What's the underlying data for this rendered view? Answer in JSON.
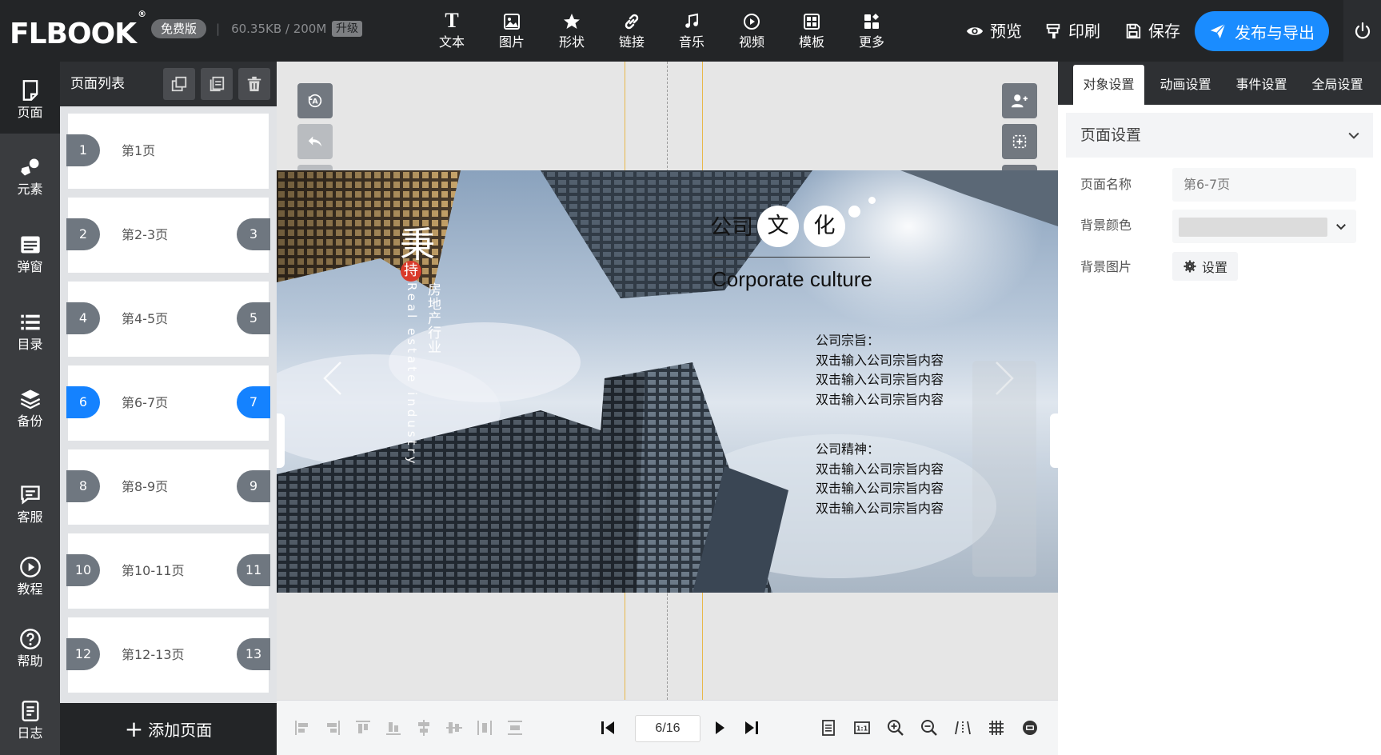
{
  "app": {
    "logo": "FLBOOK",
    "logo_mark": "®",
    "edition_badge": "免费版",
    "storage": "60.35KB / 200M",
    "storage_separator": "|",
    "upgrade": "升级"
  },
  "toolbar": {
    "items": [
      {
        "label": "文本",
        "icon": "text-icon"
      },
      {
        "label": "图片",
        "icon": "image-icon"
      },
      {
        "label": "形状",
        "icon": "star-icon"
      },
      {
        "label": "链接",
        "icon": "link-icon"
      },
      {
        "label": "音乐",
        "icon": "music-icon"
      },
      {
        "label": "视频",
        "icon": "play-circle-icon"
      },
      {
        "label": "模板",
        "icon": "template-icon"
      },
      {
        "label": "更多",
        "icon": "more-icon"
      }
    ],
    "preview": "预览",
    "print": "印刷",
    "save": "保存",
    "publish": "发布与导出"
  },
  "leftnav": {
    "items": [
      {
        "label": "页面",
        "icon": "page-icon"
      },
      {
        "label": "元素",
        "icon": "shapes-icon"
      },
      {
        "label": "弹窗",
        "icon": "popup-icon"
      },
      {
        "label": "目录",
        "icon": "list-icon"
      },
      {
        "label": "备份",
        "icon": "layers-icon"
      },
      {
        "label": "客服",
        "icon": "chat-icon"
      },
      {
        "label": "教程",
        "icon": "play-circle-icon"
      },
      {
        "label": "帮助",
        "icon": "help-icon"
      },
      {
        "label": "日志",
        "icon": "log-icon"
      }
    ]
  },
  "pagelist": {
    "title": "页面列表",
    "add_page": "添加页面",
    "pages": [
      {
        "left": "1",
        "right": "",
        "label": "第1页",
        "active": false
      },
      {
        "left": "2",
        "right": "3",
        "label": "第2-3页",
        "active": false
      },
      {
        "left": "4",
        "right": "5",
        "label": "第4-5页",
        "active": false
      },
      {
        "left": "6",
        "right": "7",
        "label": "第6-7页",
        "active": true
      },
      {
        "left": "8",
        "right": "9",
        "label": "第8-9页",
        "active": false
      },
      {
        "left": "10",
        "right": "11",
        "label": "第10-11页",
        "active": false
      },
      {
        "left": "12",
        "right": "13",
        "label": "第12-13页",
        "active": false
      }
    ]
  },
  "spread": {
    "vertical_title_big": "秉",
    "vertical_title_red": "持",
    "vertical_title_cn": "房地产行业",
    "vertical_title_en": "Real estate industry",
    "culture_prefix": "公司",
    "culture_c1": "文",
    "culture_c2": "化",
    "culture_en": "Corporate culture",
    "purpose_title": "公司宗旨：",
    "purpose_lines": [
      "双击输入公司宗旨内容",
      "双击输入公司宗旨内容",
      "双击输入公司宗旨内容"
    ],
    "spirit_title": "公司精神：",
    "spirit_lines": [
      "双击输入公司宗旨内容",
      "双击输入公司宗旨内容",
      "双击输入公司宗旨内容"
    ]
  },
  "pager": {
    "current": "6/16"
  },
  "rightpanel": {
    "tabs": [
      "对象设置",
      "动画设置",
      "事件设置",
      "全局设置"
    ],
    "section_title": "页面设置",
    "page_name_label": "页面名称",
    "page_name_value": "第6-7页",
    "bg_color_label": "背景颜色",
    "bg_image_label": "背景图片",
    "bg_image_button": "设置"
  },
  "colors": {
    "topbar": "#232527",
    "accent": "#1a8cff",
    "active_page": "#1482ff",
    "red_circle": "#d93a2b",
    "guide_orange": "#f0b040"
  }
}
